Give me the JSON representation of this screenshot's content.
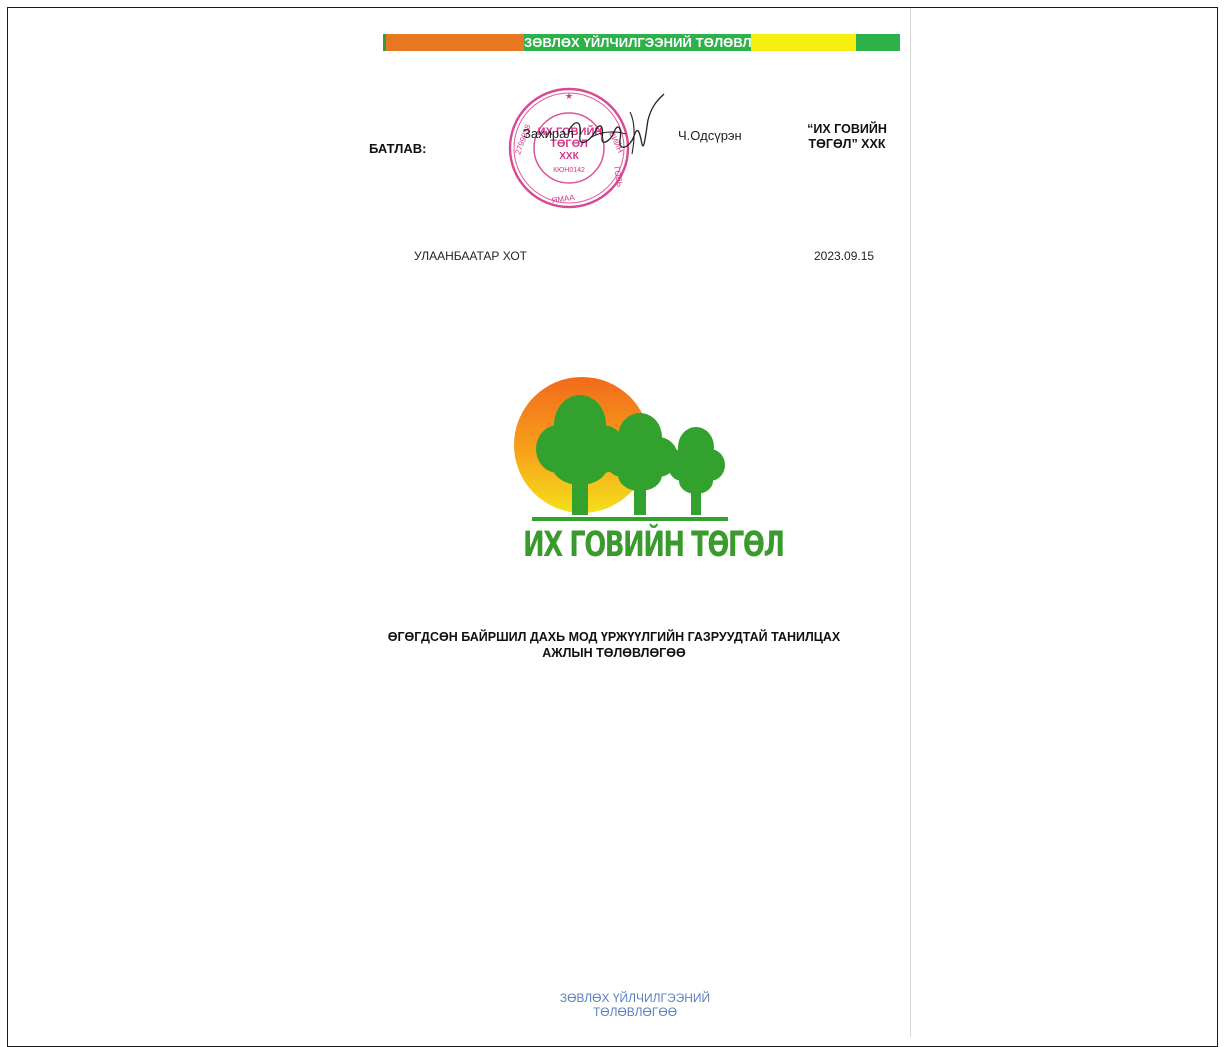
{
  "header": {
    "banner_title": "ЗӨВЛӨХ ҮЙЛЧИЛГЭЭНИЙ ТӨЛӨВЛӨГӨӨ",
    "banner_colors": {
      "orange": "#e87722",
      "green": "#2db14a",
      "yellow": "#f6ef10"
    }
  },
  "approval": {
    "label": "БАТЛАВ:",
    "director_title": "Захирал",
    "director_name": "Ч.Одсүрэн",
    "company_line1": "“ИХ ГОВИЙН",
    "company_line2": "ТӨГӨЛ” ХХК"
  },
  "stamp": {
    "line1": "ИХ ГОВИЙН",
    "line2": "ТӨГӨЛ",
    "line3": "ХХК",
    "line4": "КЮН0142",
    "color": "#d4358a"
  },
  "location": {
    "city": "УЛААНБААТАР ХОТ",
    "date": "2023.09.15"
  },
  "logo": {
    "text": "ИХ ГОВИЙН ТӨГӨЛ",
    "text_color": "#3a9a2d",
    "icon": "tree-sun-logo-icon"
  },
  "document": {
    "title_line1": "ӨГӨГДСӨН БАЙРШИЛ ДАХЬ МОД ҮРЖҮҮЛГИЙН ГАЗРУУДТАЙ ТАНИЛЦАХ",
    "title_line2": "АЖЛЫН ТӨЛӨВЛӨГӨӨ"
  },
  "footer": {
    "text": "ЗӨВЛӨХ ҮЙЛЧИЛГЭЭНИЙ ТӨЛӨВЛӨГӨӨ",
    "color": "#5b7fc0"
  }
}
